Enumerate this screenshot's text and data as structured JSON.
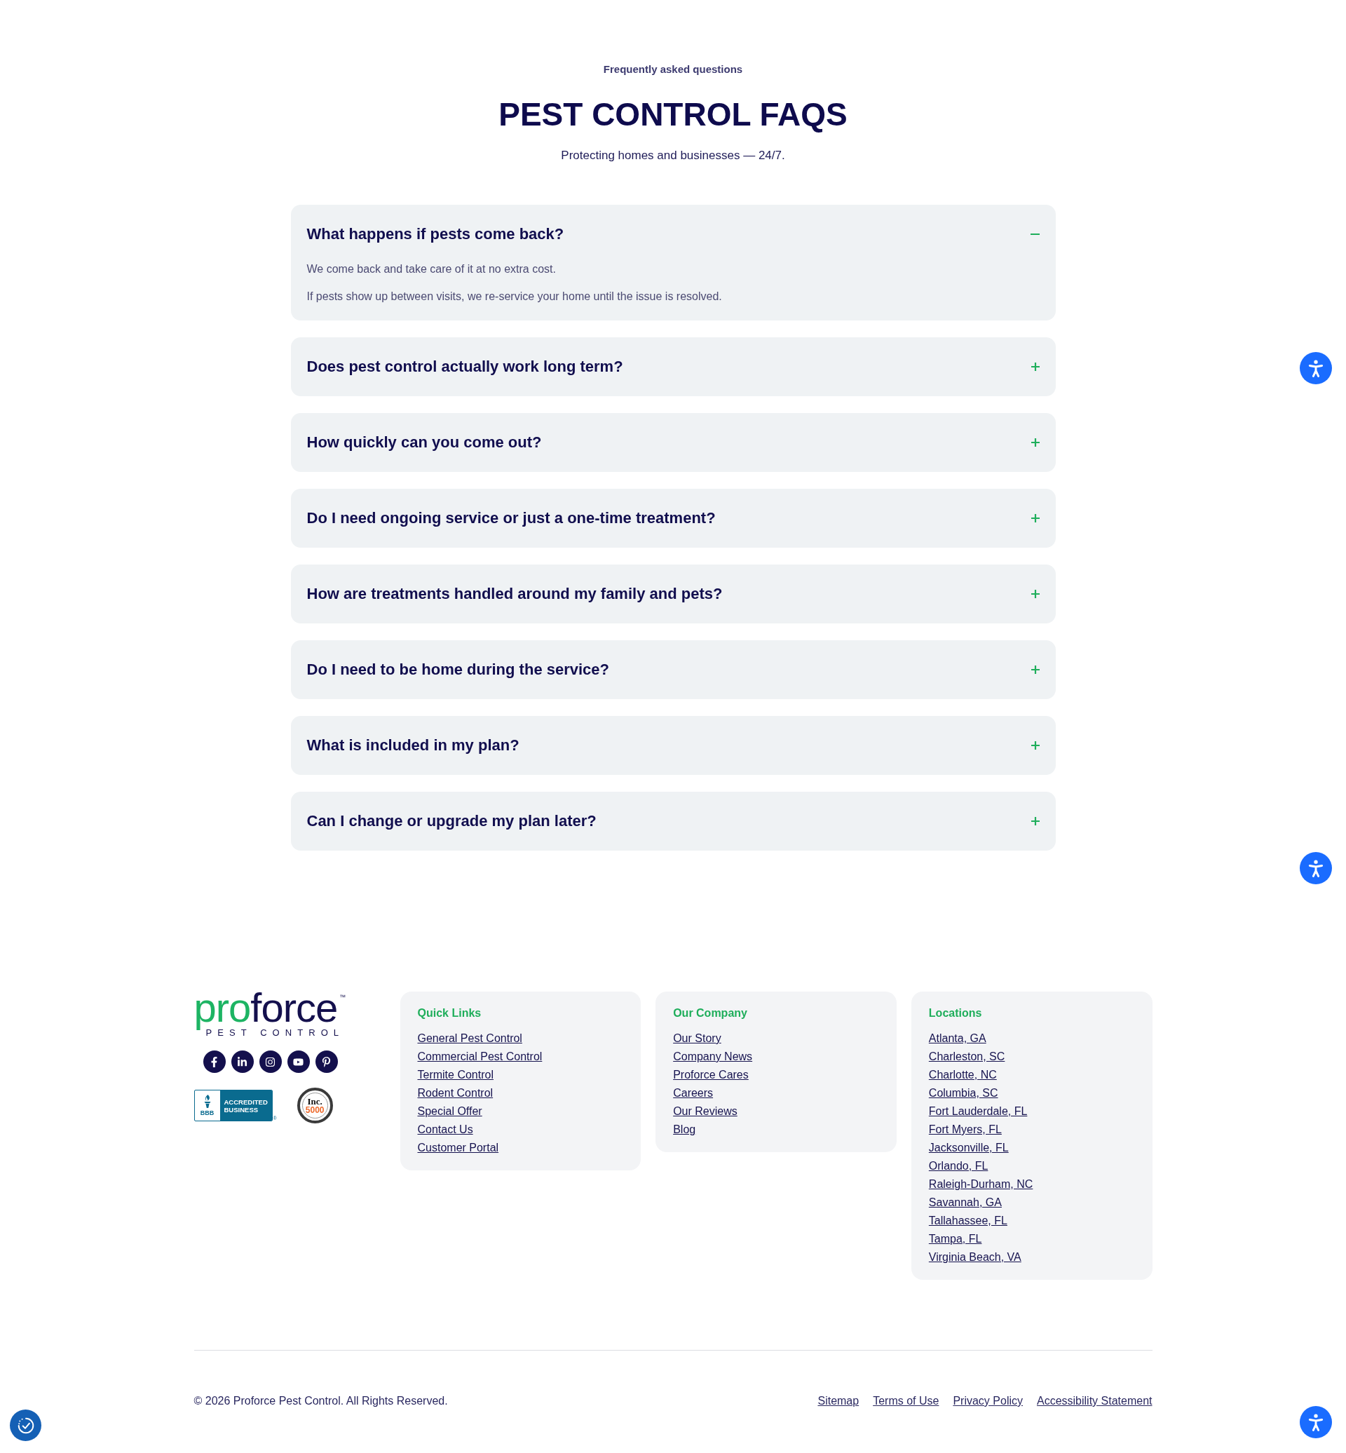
{
  "header": {
    "eyebrow": "Frequently asked questions",
    "title": "PEST CONTROL FAQS",
    "subtitle": "Protecting homes and businesses — 24/7."
  },
  "faqs": [
    {
      "question": "What happens if pests come back?",
      "expanded": true,
      "answer": [
        "We come back and take care of it at no extra cost.",
        "If pests show up between visits, we re-service your home until the issue is resolved."
      ]
    },
    {
      "question": "Does pest control actually work long term?",
      "expanded": false
    },
    {
      "question": "How quickly can you come out?",
      "expanded": false
    },
    {
      "question": "Do I need ongoing service or just a one-time treatment?",
      "expanded": false
    },
    {
      "question": "How are treatments handled around my family and pets?",
      "expanded": false
    },
    {
      "question": "Do I need to be home during the service?",
      "expanded": false
    },
    {
      "question": "What is included in my plan?",
      "expanded": false
    },
    {
      "question": "Can I change or upgrade my plan later?",
      "expanded": false
    }
  ],
  "footer": {
    "logo": {
      "wordmark_prefix": "pro",
      "wordmark_suffix": "force",
      "trademark": "™",
      "tagline": "PEST CONTROL"
    },
    "accreditation_badge": {
      "mark": "BBB",
      "label": "ACCREDITED BUSINESS",
      "registered": "®"
    },
    "award_seal": {
      "name": "Inc.",
      "number": "5000"
    },
    "columns": [
      {
        "heading": "Quick Links",
        "links": [
          "General Pest Control",
          "Commercial Pest Control",
          "Termite Control",
          "Rodent Control",
          "Special Offer",
          "Contact Us",
          "Customer Portal"
        ]
      },
      {
        "heading": "Our Company",
        "links": [
          "Our Story",
          "Company News",
          "Proforce Cares",
          "Careers",
          "Our Reviews",
          "Blog"
        ]
      },
      {
        "heading": "Locations",
        "links": [
          "Atlanta, GA",
          "Charleston, SC",
          "Charlotte, NC",
          "Columbia, SC",
          "Fort Lauderdale, FL",
          "Fort Myers, FL",
          "Jacksonville, FL",
          "Orlando, FL",
          "Raleigh-Durham, NC",
          "Savannah, GA",
          "Tallahassee, FL",
          "Tampa, FL",
          "Virginia Beach, VA"
        ]
      }
    ],
    "copyright": "© 2026 Proforce Pest Control. All Rights Reserved.",
    "legal_links": [
      "Sitemap",
      "Terms of Use",
      "Privacy Policy",
      "Accessibility Statement"
    ]
  }
}
